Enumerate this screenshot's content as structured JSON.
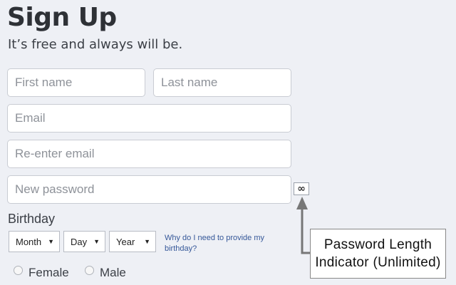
{
  "header": {
    "title": "Sign Up",
    "subtitle": "It’s free and always will be."
  },
  "form": {
    "first_name_placeholder": "First name",
    "last_name_placeholder": "Last name",
    "email_placeholder": "Email",
    "reenter_email_placeholder": "Re-enter email",
    "password_placeholder": "New password",
    "password_length_symbol": "∞",
    "birthday_label": "Birthday",
    "birthday_month": "Month",
    "birthday_day": "Day",
    "birthday_year": "Year",
    "why_birthday_link": "Why do I need to provide my birthday?",
    "gender_female": "Female",
    "gender_male": "Male",
    "dropdown_arrow": "▼"
  },
  "annotation": {
    "line1": "Password Length",
    "line2": "Indicator (Unlimited)"
  },
  "colors": {
    "background": "#eef0f5",
    "link": "#365899",
    "field_border": "#c9ccd3",
    "arrow": "#777777"
  }
}
